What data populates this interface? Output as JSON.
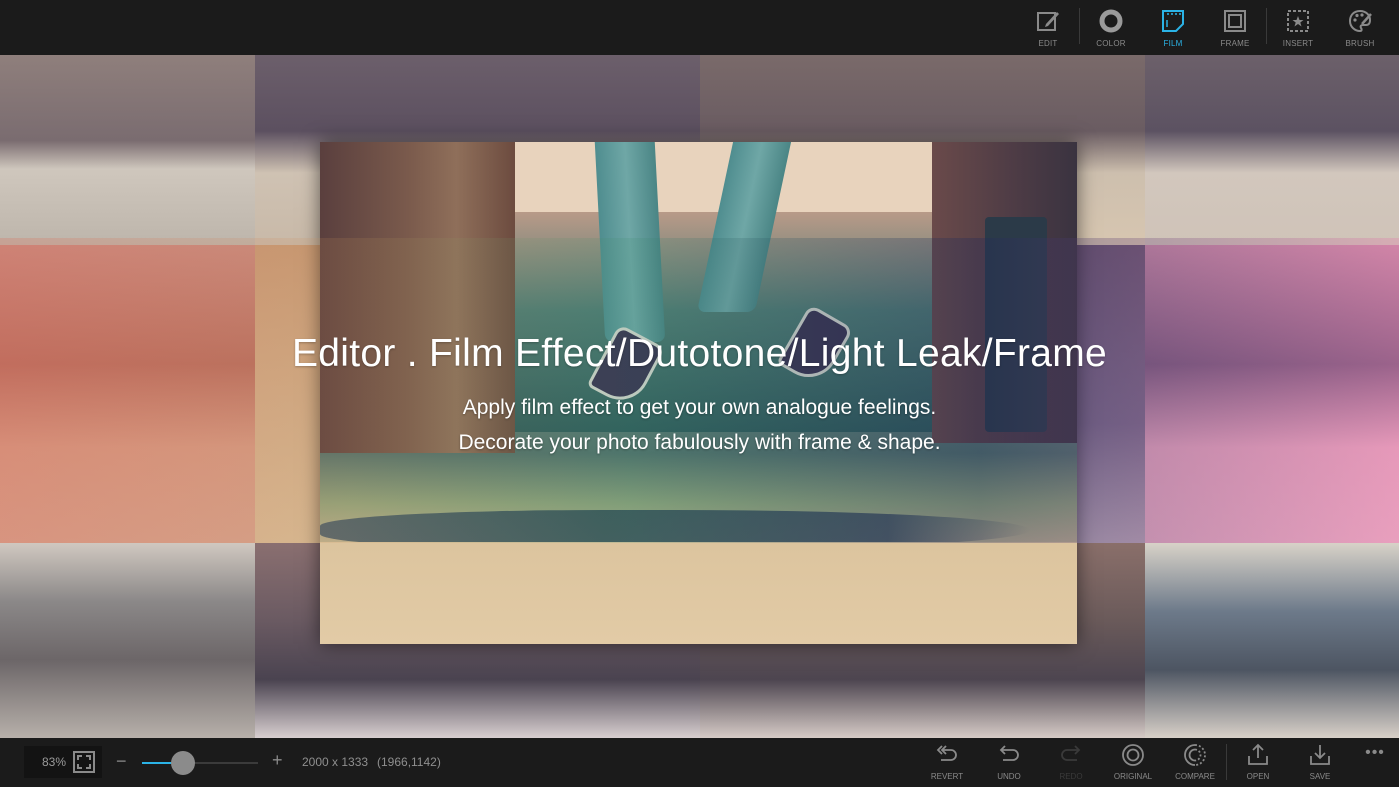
{
  "toolbar": {
    "tools": [
      {
        "id": "edit",
        "label": "EDIT",
        "icon": "edit-icon",
        "active": false
      },
      {
        "id": "color",
        "label": "COLOR",
        "icon": "color-ring-icon",
        "active": false
      },
      {
        "id": "film",
        "label": "FILM",
        "icon": "film-icon",
        "active": true
      },
      {
        "id": "frame",
        "label": "FRAME",
        "icon": "frame-icon",
        "active": false
      },
      {
        "id": "insert",
        "label": "INSERT",
        "icon": "insert-star-icon",
        "active": false
      },
      {
        "id": "brush",
        "label": "BRUSH",
        "icon": "palette-brush-icon",
        "active": false
      }
    ]
  },
  "canvas": {
    "headline": "Editor . Film Effect/Dutotone/Light Leak/Frame",
    "subline1": "Apply film effect to get your own analogue feelings.",
    "subline2": "Decorate your photo fabulously with frame & shape."
  },
  "statusbar": {
    "zoom_percent": "83%",
    "zoom_level": 0.35,
    "minus_label": "−",
    "plus_label": "+",
    "image_dimensions": "2000 x 1333",
    "cursor_coords": "(1966,1142)"
  },
  "actions": [
    {
      "id": "revert",
      "label": "REVERT",
      "icon": "revert-icon",
      "enabled": true
    },
    {
      "id": "undo",
      "label": "UNDO",
      "icon": "undo-icon",
      "enabled": true
    },
    {
      "id": "redo",
      "label": "REDO",
      "icon": "redo-icon",
      "enabled": false
    },
    {
      "id": "original",
      "label": "ORIGINAL",
      "icon": "original-icon",
      "enabled": true
    },
    {
      "id": "compare",
      "label": "COMPARE",
      "icon": "compare-icon",
      "enabled": true
    },
    {
      "id": "open",
      "label": "OPEN",
      "icon": "open-upload-icon",
      "enabled": true
    },
    {
      "id": "save",
      "label": "SAVE",
      "icon": "save-download-icon",
      "enabled": true
    }
  ],
  "more_label": "•••",
  "colors": {
    "accent": "#2bb3e6",
    "bar_bg": "#1b1b1b",
    "icon_gray": "#8a8a8a"
  }
}
